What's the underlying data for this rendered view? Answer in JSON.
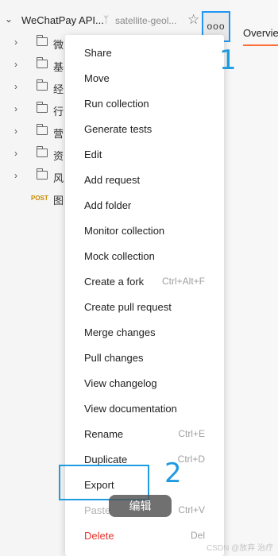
{
  "collection": {
    "name": "WeChatPay API...",
    "fork_label": "satellite-geol...",
    "chevron": "chevron-down-icon",
    "star_icon": "star-icon",
    "more_label": "ooo"
  },
  "tree": {
    "folders": [
      {
        "label": "微"
      },
      {
        "label": "基"
      },
      {
        "label": "经"
      },
      {
        "label": "行"
      },
      {
        "label": "营"
      },
      {
        "label": "资"
      },
      {
        "label": "风"
      }
    ],
    "request": {
      "method": "POST",
      "label": "图"
    }
  },
  "tab": {
    "label": "Overvie",
    "accent": "#ff6c37"
  },
  "menu": {
    "items": [
      {
        "label": "Share",
        "shortcut": ""
      },
      {
        "label": "Move",
        "shortcut": ""
      },
      {
        "label": "Run collection",
        "shortcut": ""
      },
      {
        "label": "Generate tests",
        "shortcut": ""
      },
      {
        "label": "Edit",
        "shortcut": ""
      },
      {
        "label": "Add request",
        "shortcut": ""
      },
      {
        "label": "Add folder",
        "shortcut": ""
      },
      {
        "label": "Monitor collection",
        "shortcut": ""
      },
      {
        "label": "Mock collection",
        "shortcut": ""
      },
      {
        "label": "Create a fork",
        "shortcut": "Ctrl+Alt+F"
      },
      {
        "label": "Create pull request",
        "shortcut": ""
      },
      {
        "label": "Merge changes",
        "shortcut": ""
      },
      {
        "label": "Pull changes",
        "shortcut": ""
      },
      {
        "label": "View changelog",
        "shortcut": ""
      },
      {
        "label": "View documentation",
        "shortcut": ""
      },
      {
        "label": "Rename",
        "shortcut": "Ctrl+E"
      },
      {
        "label": "Duplicate",
        "shortcut": "Ctrl+D"
      },
      {
        "label": "Export",
        "shortcut": ""
      },
      {
        "label": "Paste",
        "shortcut": "Ctrl+V",
        "disabled": true
      },
      {
        "label": "Delete",
        "shortcut": "Del",
        "danger": true
      }
    ]
  },
  "annotations": {
    "step1": "1",
    "step2": "2",
    "highlight_color": "#1e9be0"
  },
  "overlay": {
    "edit_label": "编辑"
  },
  "watermark": "CSDN @放弃    治疗"
}
